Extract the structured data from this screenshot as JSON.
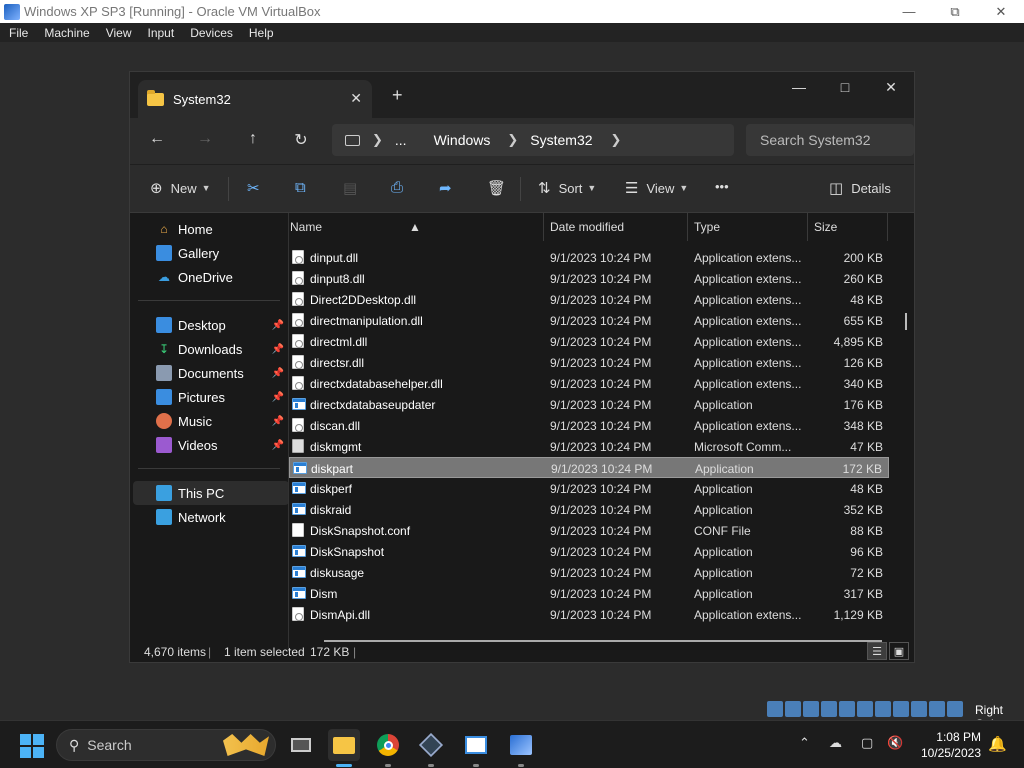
{
  "vbox": {
    "title": "Windows XP SP3 [Running] - Oracle VM VirtualBox",
    "menu": [
      "File",
      "Machine",
      "View",
      "Input",
      "Devices",
      "Help"
    ],
    "host_key": "Right Ctrl"
  },
  "explorer": {
    "tab_title": "System32",
    "breadcrumb": [
      "...",
      "Windows",
      "System32"
    ],
    "search_placeholder": "Search System32",
    "commands": {
      "new": "New",
      "sort": "Sort",
      "view": "View",
      "more": "•••",
      "details": "Details"
    },
    "sidebar": {
      "quick": [
        "Home",
        "Gallery",
        "OneDrive"
      ],
      "pinned": [
        "Desktop",
        "Downloads",
        "Documents",
        "Pictures",
        "Music",
        "Videos"
      ],
      "devices": [
        "This PC",
        "Network"
      ]
    },
    "columns": {
      "name": "Name",
      "date": "Date modified",
      "type": "Type",
      "size": "Size"
    },
    "files": [
      {
        "name": "dinput.dll",
        "date": "9/1/2023 10:24 PM",
        "type": "Application extens...",
        "size": "200 KB",
        "icon": "dll"
      },
      {
        "name": "dinput8.dll",
        "date": "9/1/2023 10:24 PM",
        "type": "Application extens...",
        "size": "260 KB",
        "icon": "dll"
      },
      {
        "name": "Direct2DDesktop.dll",
        "date": "9/1/2023 10:24 PM",
        "type": "Application extens...",
        "size": "48 KB",
        "icon": "dll"
      },
      {
        "name": "directmanipulation.dll",
        "date": "9/1/2023 10:24 PM",
        "type": "Application extens...",
        "size": "655 KB",
        "icon": "dll"
      },
      {
        "name": "directml.dll",
        "date": "9/1/2023 10:24 PM",
        "type": "Application extens...",
        "size": "4,895 KB",
        "icon": "dll"
      },
      {
        "name": "directsr.dll",
        "date": "9/1/2023 10:24 PM",
        "type": "Application extens...",
        "size": "126 KB",
        "icon": "dll"
      },
      {
        "name": "directxdatabasehelper.dll",
        "date": "9/1/2023 10:24 PM",
        "type": "Application extens...",
        "size": "340 KB",
        "icon": "dll"
      },
      {
        "name": "directxdatabaseupdater",
        "date": "9/1/2023 10:24 PM",
        "type": "Application",
        "size": "176 KB",
        "icon": "app"
      },
      {
        "name": "discan.dll",
        "date": "9/1/2023 10:24 PM",
        "type": "Application extens...",
        "size": "348 KB",
        "icon": "dll"
      },
      {
        "name": "diskmgmt",
        "date": "9/1/2023 10:24 PM",
        "type": "Microsoft Comm...",
        "size": "47 KB",
        "icon": "msc"
      },
      {
        "name": "diskpart",
        "date": "9/1/2023 10:24 PM",
        "type": "Application",
        "size": "172 KB",
        "icon": "app",
        "selected": true
      },
      {
        "name": "diskperf",
        "date": "9/1/2023 10:24 PM",
        "type": "Application",
        "size": "48 KB",
        "icon": "app"
      },
      {
        "name": "diskraid",
        "date": "9/1/2023 10:24 PM",
        "type": "Application",
        "size": "352 KB",
        "icon": "app"
      },
      {
        "name": "DiskSnapshot.conf",
        "date": "9/1/2023 10:24 PM",
        "type": "CONF File",
        "size": "88 KB",
        "icon": "file"
      },
      {
        "name": "DiskSnapshot",
        "date": "9/1/2023 10:24 PM",
        "type": "Application",
        "size": "96 KB",
        "icon": "app"
      },
      {
        "name": "diskusage",
        "date": "9/1/2023 10:24 PM",
        "type": "Application",
        "size": "72 KB",
        "icon": "app"
      },
      {
        "name": "Dism",
        "date": "9/1/2023 10:24 PM",
        "type": "Application",
        "size": "317 KB",
        "icon": "app"
      },
      {
        "name": "DismApi.dll",
        "date": "9/1/2023 10:24 PM",
        "type": "Application extens...",
        "size": "1,129 KB",
        "icon": "dll"
      }
    ],
    "status": {
      "items": "4,670 items",
      "selected": "1 item selected",
      "size": "172 KB"
    }
  },
  "taskbar": {
    "search_label": "Search",
    "time": "1:08 PM",
    "date": "10/25/2023"
  }
}
